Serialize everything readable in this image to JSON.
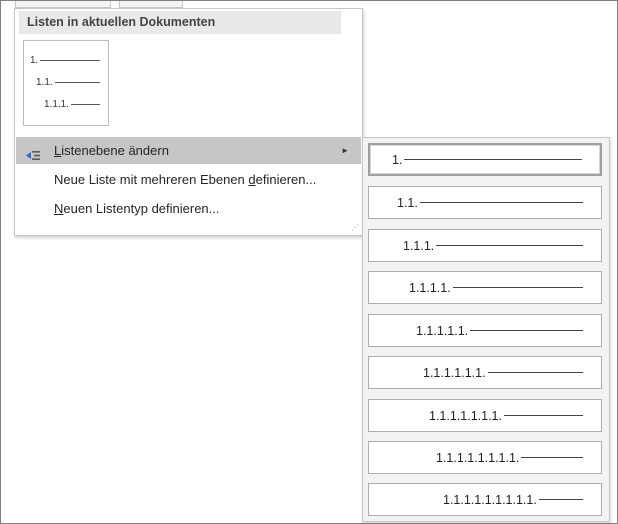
{
  "main_menu": {
    "section_header": "Listen in aktuellen Dokumenten",
    "thumbnail": {
      "lines": [
        "1.",
        "1.1.",
        "1.1.1."
      ]
    },
    "items": [
      {
        "label_pre": "",
        "label_accel": "L",
        "label_post": "istenebene ändern",
        "icon": "list-level-icon",
        "has_submenu": true,
        "highlighted": true
      },
      {
        "label_pre": "Neue Liste mit mehreren Ebenen ",
        "label_accel": "d",
        "label_post": "efinieren...",
        "icon": "",
        "has_submenu": false,
        "highlighted": false
      },
      {
        "label_pre": "",
        "label_accel": "N",
        "label_post": "euen Listentyp definieren...",
        "icon": "",
        "has_submenu": false,
        "highlighted": false
      }
    ],
    "submenu_arrow": "►"
  },
  "submenu": {
    "levels": [
      "1.",
      "1.1.",
      "1.1.1.",
      "1.1.1.1.",
      "1.1.1.1.1.",
      "1.1.1.1.1.1.",
      "1.1.1.1.1.1.1.",
      "1.1.1.1.1.1.1.1.",
      "1.1.1.1.1.1.1.1.1."
    ],
    "selected_index": 0
  },
  "colors": {
    "highlight": "#c6c6c6",
    "header_bg": "#e9e9e9",
    "submenu_bg": "#f3f3f3",
    "icon_blue": "#2b6cc4"
  }
}
